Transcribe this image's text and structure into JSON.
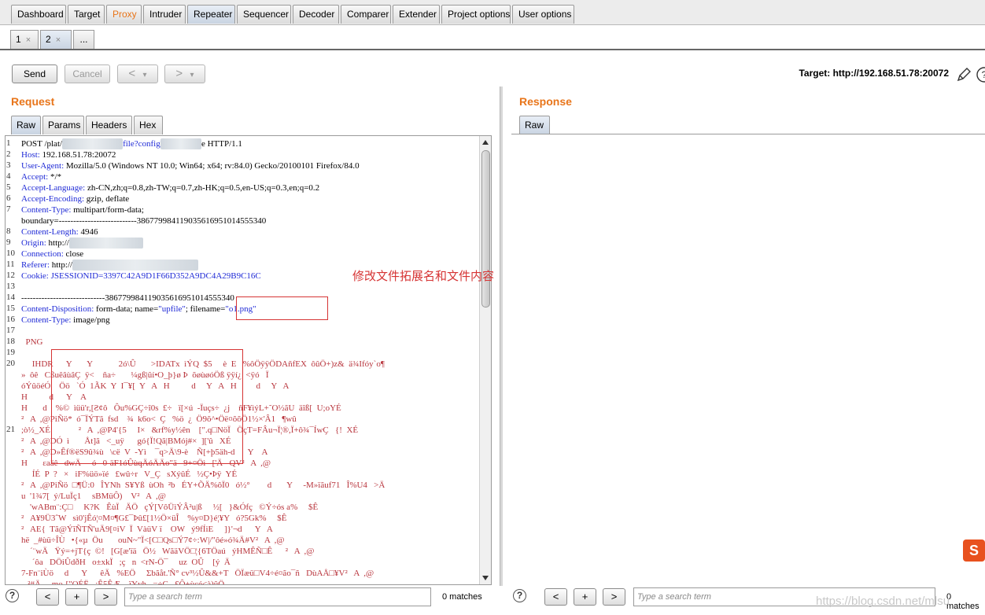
{
  "top_tabs": [
    {
      "label": "Dashboard",
      "state": "normal"
    },
    {
      "label": "Target",
      "state": "normal"
    },
    {
      "label": "Proxy",
      "state": "highlight"
    },
    {
      "label": "Intruder",
      "state": "normal"
    },
    {
      "label": "Repeater",
      "state": "active"
    },
    {
      "label": "Sequencer",
      "state": "normal"
    },
    {
      "label": "Decoder",
      "state": "normal"
    },
    {
      "label": "Comparer",
      "state": "normal"
    },
    {
      "label": "Extender",
      "state": "normal"
    },
    {
      "label": "Project options",
      "state": "normal"
    },
    {
      "label": "User options",
      "state": "normal"
    }
  ],
  "repeater_tabs": [
    {
      "label": "1",
      "close": "×"
    },
    {
      "label": "2",
      "close": "×"
    },
    {
      "label": "..."
    }
  ],
  "toolbar": {
    "send_label": "Send",
    "cancel_label": "Cancel",
    "back_label": "<",
    "forward_label": ">",
    "dropdown_glyph": "▾",
    "target_label": "Target: http://192.168.51.78:20072",
    "edit_icon": "pencil-icon",
    "help_icon": "question-icon"
  },
  "request": {
    "title": "Request",
    "tabs": [
      "Raw",
      "Params",
      "Headers",
      "Hex"
    ],
    "lines": [
      {
        "n": "1",
        "parts": [
          {
            "t": "POST /plat/",
            "c": "hval"
          },
          {
            "t": "xxxxxxxx/upload",
            "c": "blur"
          },
          {
            "t": "file?config",
            "c": "hstr"
          },
          {
            "t": " xxxxxxxxx",
            "c": "blur"
          },
          {
            "t": "e HTTP/1.1",
            "c": "hval"
          }
        ]
      },
      {
        "n": "2",
        "parts": [
          {
            "t": "Host:",
            "c": "hname"
          },
          {
            "t": " 192.168.51.78:20072",
            "c": "hval"
          }
        ]
      },
      {
        "n": "3",
        "parts": [
          {
            "t": "User-Agent:",
            "c": "hname"
          },
          {
            "t": " Mozilla/5.0 (Windows NT 10.0; Win64; x64; rv:84.0) Gecko/20100101 Firefox/84.0",
            "c": "hval"
          }
        ]
      },
      {
        "n": "4",
        "parts": [
          {
            "t": "Accept:",
            "c": "hname"
          },
          {
            "t": " */*",
            "c": "hval"
          }
        ]
      },
      {
        "n": "5",
        "parts": [
          {
            "t": "Accept-Language:",
            "c": "hname"
          },
          {
            "t": " zh-CN,zh;q=0.8,zh-TW;q=0.7,zh-HK;q=0.5,en-US;q=0.3,en;q=0.2",
            "c": "hval"
          }
        ]
      },
      {
        "n": "6",
        "parts": [
          {
            "t": "Accept-Encoding:",
            "c": "hname"
          },
          {
            "t": " gzip, deflate",
            "c": "hval"
          }
        ]
      },
      {
        "n": "7",
        "parts": [
          {
            "t": "Content-Type:",
            "c": "hname"
          },
          {
            "t": " multipart/form-data;",
            "c": "hval"
          }
        ]
      },
      {
        "n": "",
        "parts": [
          {
            "t": "boundary=---------------------------386779984119035616951014555340",
            "c": "hval"
          }
        ]
      },
      {
        "n": "8",
        "parts": [
          {
            "t": "Content-Length:",
            "c": "hname"
          },
          {
            "t": " 4946",
            "c": "hval"
          }
        ]
      },
      {
        "n": "9",
        "parts": [
          {
            "t": "Origin:",
            "c": "hname"
          },
          {
            "t": " http://",
            "c": "hval"
          },
          {
            "t": "xxx.xxx.xx.xx:xxxxx",
            "c": "blur"
          }
        ]
      },
      {
        "n": "10",
        "parts": [
          {
            "t": "Connection:",
            "c": "hname"
          },
          {
            "t": " close",
            "c": "hval"
          }
        ]
      },
      {
        "n": "11",
        "parts": [
          {
            "t": "Referer:",
            "c": "hname"
          },
          {
            "t": " http://",
            "c": "hval"
          },
          {
            "t": "xxx.xxx.xx.xx:xxxxx/xxxx/xxxxxxx",
            "c": "blur"
          }
        ]
      },
      {
        "n": "12",
        "parts": [
          {
            "t": "Cookie:",
            "c": "hname"
          },
          {
            "t": " JSESSIONID=3397C42A9D1F66D352A9DC4A29B9C16C",
            "c": "hstr"
          }
        ]
      },
      {
        "n": "13",
        "parts": [
          {
            "t": "",
            "c": "hval"
          }
        ]
      },
      {
        "n": "14",
        "parts": [
          {
            "t": "-----------------------------386779984119035616951014555340",
            "c": "hval"
          }
        ]
      },
      {
        "n": "15",
        "parts": [
          {
            "t": "Content-Disposition:",
            "c": "hname"
          },
          {
            "t": " form-data; name=",
            "c": "hval"
          },
          {
            "t": "\"upfile\"",
            "c": "hstr"
          },
          {
            "t": "; filename=",
            "c": "hval"
          },
          {
            "t": "\"o1.png\"",
            "c": "hstr"
          }
        ]
      },
      {
        "n": "16",
        "parts": [
          {
            "t": "Content-Type:",
            "c": "hname"
          },
          {
            "t": " image/png",
            "c": "hval"
          }
        ]
      },
      {
        "n": "17",
        "parts": [
          {
            "t": "",
            "c": "hval"
          }
        ]
      },
      {
        "n": "18",
        "parts": [
          {
            "t": "  PNG",
            "c": "bin"
          }
        ]
      },
      {
        "n": "19",
        "parts": [
          {
            "t": "",
            "c": "hval"
          }
        ]
      },
      {
        "n": "20",
        "parts": [
          {
            "t": "     IHDR      Y       Y            2ó\\Û       >IDATx  ìÝQ  $5     è  E   %ôÖÿÿÖDAñfEX  ôûÖ+)z&  ä¾Ifóy`o¶",
            "c": "bin"
          }
        ]
      },
      {
        "n": "",
        "parts": [
          {
            "t": "»  ôê   CßuêâùâÇ  ÿ<    ña÷       ¼gß|ûí•O_þ}ø Þ  õøùøóÖß ÿÿí¿  <ÿó   Ï",
            "c": "bin"
          }
        ]
      },
      {
        "n": "",
        "parts": [
          {
            "t": "óÝûöéÓ    Öö   `Ó  1ÃK  Y  I¯¥[  Y   A   H          d     Y   A   H         d     Y   A",
            "c": "bin"
          }
        ]
      },
      {
        "n": "",
        "parts": [
          {
            "t": "H          d      Y    A",
            "c": "bin"
          }
        ]
      },
      {
        "n": "",
        "parts": [
          {
            "t": "H       d    %©  ìüü'r,[Ƨ¢ô   Ôu%GÇ÷î0s  £÷   ï[×ú  -Ïuçs÷  ¿j    ñF¥ìýL+˜O½ãU  äîß[  U;oYÉ",
            "c": "bin"
          }
        ]
      },
      {
        "n": "",
        "parts": [
          {
            "t": "²   A  ,@PiÑö*  ó¯ÏÝTã  fsd    ¾  k6o<  Ç   %ö  ¿  Ö9õ^•Öë¤õõÖ1½×'Â1   ¶wû",
            "c": "bin"
          }
        ]
      },
      {
        "n": "21",
        "parts": [
          {
            "t": ";ò½_XÉ             ²   A  ,@P4'{5     I×   &rf%y½ên    [\".q□NöÏ   ÖçT=FÂu¬Ï¦®,Ï+ô¾¯ÍwÇ   {!  XÉ",
            "c": "bin"
          }
        ]
      },
      {
        "n": "",
        "parts": [
          {
            "t": "²   A  ,@DÓ  ì       Åt]ã   <_uÿ      gó{Ï!Qã|BMój#×  ]['û   XÉ",
            "c": "bin"
          }
        ]
      },
      {
        "n": "",
        "parts": [
          {
            "t": "²   A  ,@D»Êf®ëS9û¾ù   \\cë  V  -Yì    ¯q>Ä\\9-è    Ñ[+þ5äh-d      Y    A",
            "c": "bin"
          }
        ]
      },
      {
        "n": "",
        "parts": [
          {
            "t": "H       ɛaäê   dwÄ     ó   0-äF1óÛùqÄóÄÄo\"ä   9+¤Öì   ['Ä   QV²   A  ,@",
            "c": "bin"
          }
        ]
      },
      {
        "n": "",
        "parts": [
          {
            "t": "     ÍÉ  P  ?   ×   iF%üö»ïé   £wû÷r   V_Ç   sXýûÉ   ½Ç•Þÿ  YÉ",
            "c": "bin"
          }
        ]
      },
      {
        "n": "",
        "parts": [
          {
            "t": "²   A  ,@PiÑö  □¶Ü:0   ÎYNh  S¥Yß  ùOh  ²b   ÉY+ÕÄ%ôÏ0   ó½°        d       Y     -M»ïãuf71   Î%U4   >Ä",
            "c": "bin"
          }
        ]
      },
      {
        "n": "",
        "parts": [
          {
            "t": "u  '1¾7[  ý/LuÏç1     sBMüÔ)    V²   A  ,@",
            "c": "bin"
          }
        ]
      },
      {
        "n": "",
        "parts": [
          {
            "t": "    'wABm¨:Ç□     K?K   ÊùÏ   ÄÖ   çÝ[VôÜìÝÂ²u|ß     ½[   }&Ófç   ©Ý÷ós a%     $Ê",
            "c": "bin"
          }
        ]
      },
      {
        "n": "",
        "parts": [
          {
            "t": "²   A¥9Ü3ˆW   sì0'jÊó¦¤M¤¶G£¯Þû£[1½Ö×üÎ    %y¤D}é¦¥Y   ó?5Gk%     $Ê",
            "c": "bin"
          }
        ]
      },
      {
        "n": "",
        "parts": [
          {
            "t": "²   AE{  Tã@ÝîÑTÑ'uÄ9[¤iV  Ï  VàüV ï    OW   ý9fÍiE     ]}'¬d      Y   A",
            "c": "bin"
          }
        ]
      },
      {
        "n": "",
        "parts": [
          {
            "t": "hë  _#ùü÷ÎÙ   •{«µ  Öu       ouN~\"Ï<[C□Qs□Ý7¢÷:W|/\"ôé»ó¾Ä#V²   A  ,@",
            "c": "bin"
          }
        ]
      },
      {
        "n": "",
        "parts": [
          {
            "t": "    ´¨wÄ   Ÿý=+jT{ç  ©!   [G[æ'ïä   Ö½   WãäVÖ□¦{6TÖaú   ýHMÊÑ□Ê      ²   A  ,@",
            "c": "bin"
          }
        ]
      },
      {
        "n": "",
        "parts": [
          {
            "t": "     ´ôa   DÖiÛdðH   o±xkÏ   ;ç   n  <rN-Ö¯     uz  OÛ    [ý  Ä",
            "c": "bin"
          }
        ]
      },
      {
        "n": "",
        "parts": [
          {
            "t": "7-Fn¨iÙö     d      Y      êÄ   %EÖ     Σbãåt.'Ñ° cv³½Û&&+T   ÖÏæü□V4÷é¤ão¯ñ   DùAÅ□¥V²   A  ,@",
            "c": "bin"
          }
        ]
      },
      {
        "n": "",
        "parts": [
          {
            "t": "   ²#Ä     mo-[\"OÉË   :Ê5ÊÆ    ïYyh   =÷C   £Ô+ùçé<à)ûÖ",
            "c": "bin"
          }
        ]
      }
    ]
  },
  "annotation": {
    "text": "修改文件拓展名和文件内容"
  },
  "response": {
    "title": "Response",
    "tabs": [
      "Raw"
    ]
  },
  "search_left": {
    "help": "?",
    "prev": "<",
    "add": "+",
    "next": ">",
    "placeholder": "Type a search term",
    "matches": "0 matches"
  },
  "search_right": {
    "help": "?",
    "prev": "<",
    "add": "+",
    "next": ">",
    "placeholder": "Type a search term",
    "matches": "0 matches"
  },
  "watermark": "https://blog.csdn.net/mlsu",
  "badge_glyph": "S"
}
